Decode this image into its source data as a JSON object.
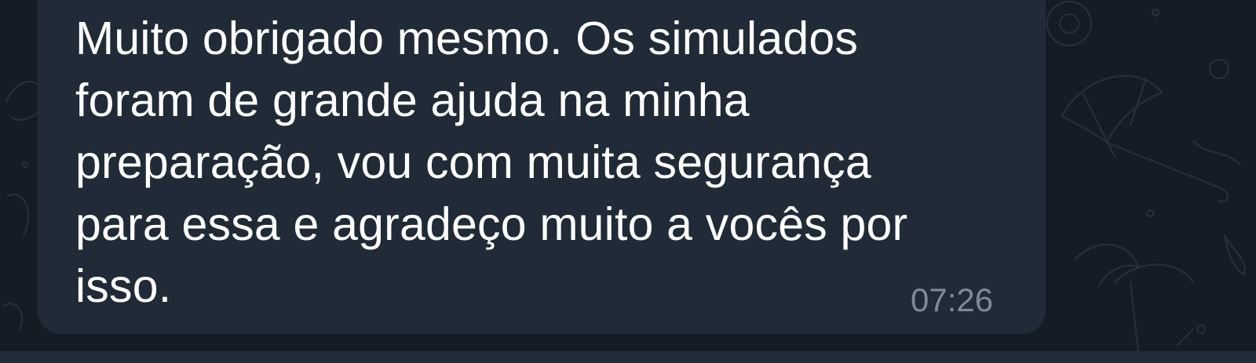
{
  "chat": {
    "background_color": "#141c26",
    "background_pattern": "telegram-doodle-wallpaper"
  },
  "message": {
    "text": "Muito obrigado mesmo. Os simulados\nforam de grande ajuda na minha\npreparação, vou com muita segurança\npara essa e agradeço muito a vocês por\nisso.",
    "time": "07:26",
    "bubble_color": "#212b37",
    "text_color": "#ffffff",
    "time_color": "#7f8a97"
  }
}
